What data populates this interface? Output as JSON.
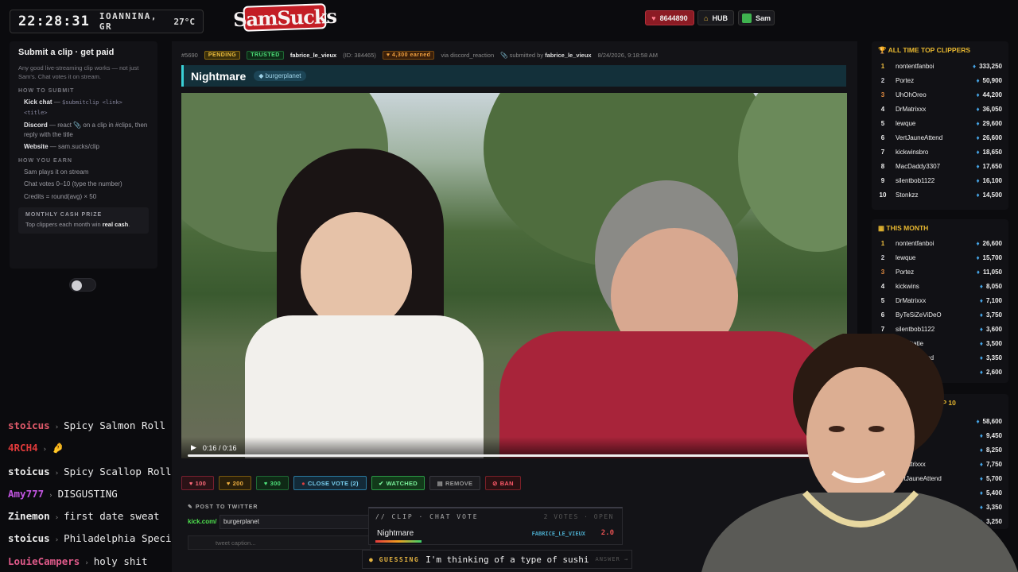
{
  "header": {
    "time": "22:28:31",
    "location": "IOANNINA, GR",
    "temp": "27°C",
    "logo": "SamSucks",
    "credits": "8644890",
    "hub": "HUB",
    "user": "Sam"
  },
  "left": {
    "title": "Submit a clip · get paid",
    "intro": "Any good live-streaming clip works — not just Sam's. Chat votes it on stream.",
    "how_submit": "HOW TO SUBMIT",
    "kick_l": "Kick chat",
    "kick_r": " — ",
    "kick_code": "$submitclip <link> <title>",
    "discord_l": "Discord",
    "discord_r": " — react 📎 on a clip in #clips, then reply with the title",
    "web_l": "Website",
    "web_r": " — sam.sucks/clip",
    "how_earn": "HOW YOU EARN",
    "earn": [
      "Sam plays it on stream",
      "Chat votes 0–10 (type the number)",
      "Credits = round(avg) × 50"
    ],
    "prize_t": "MONTHLY CASH PRIZE",
    "prize_d": "Top clippers each month win ",
    "prize_b": "real cash",
    "prize_e": "."
  },
  "chat": [
    {
      "user": "stoicus",
      "color": "#e05a6a",
      "msg": "Spicy Salmon Roll"
    },
    {
      "user": "4RCH4",
      "color": "#e03a3a",
      "msg": "🤌"
    },
    {
      "user": "stoicus",
      "color": "#ececec",
      "msg": "Spicy Scallop Roll"
    },
    {
      "user": "Amy777",
      "color": "#c255e0",
      "msg": "DISGUSTING"
    },
    {
      "user": "Zinemon",
      "color": "#ececec",
      "msg": "first date sweat"
    },
    {
      "user": "stoicus",
      "color": "#ececec",
      "msg": "Philadelphia Special Roll"
    },
    {
      "user": "LouieCampers",
      "color": "#e05a8a",
      "msg": "holy shit"
    }
  ],
  "clip": {
    "id": "#5690",
    "status": "PENDING",
    "trust": "TRUSTED",
    "author": "fabrice_le_vieux",
    "author_id": "(ID: 384465)",
    "earned": "4,300 earned",
    "via": "via discord_reaction",
    "submitted_label": "submitted by",
    "submitted_by": "fabrice_le_vieux",
    "date": "8/24/2026, 9:18:58 AM",
    "title": "Nightmare",
    "tag": "burgerplanet",
    "time": "0:16 / 0:16",
    "actions": [
      "100",
      "200",
      "300",
      "CLOSE VOTE (2)",
      "WATCHED",
      "REMOVE",
      "BAN"
    ],
    "post_label": "POST TO TWITTER",
    "kick_label": "kick.com/",
    "kick_value": "burgerplanet",
    "caption_placeholder": "tweet caption..."
  },
  "vote": {
    "header": "// CLIP · CHAT VOTE",
    "status": "2 VOTES · OPEN",
    "name": "Nightmare",
    "submitter": "FABRICE_LE_VIEUX",
    "score": "2.0"
  },
  "guess": {
    "label": "GUESSING",
    "question": "I'm thinking of a type of sushi",
    "answer": "ANSWER →"
  },
  "alltime": {
    "title": "ALL TIME TOP CLIPPERS",
    "rows": [
      {
        "r": "1",
        "n": "nontentfanboi",
        "c": "333,250"
      },
      {
        "r": "2",
        "n": "Portez",
        "c": "50,900"
      },
      {
        "r": "3",
        "n": "UhOhOreo",
        "c": "44,200"
      },
      {
        "r": "4",
        "n": "DrMatrixxx",
        "c": "36,050"
      },
      {
        "r": "5",
        "n": "lewque",
        "c": "29,600"
      },
      {
        "r": "6",
        "n": "VertJauneAttend",
        "c": "26,600"
      },
      {
        "r": "7",
        "n": "kickwinsbro",
        "c": "18,650"
      },
      {
        "r": "8",
        "n": "MacDaddy3307",
        "c": "17,650"
      },
      {
        "r": "9",
        "n": "silentbob1122",
        "c": "16,100"
      },
      {
        "r": "10",
        "n": "Stonkzz",
        "c": "14,500"
      }
    ]
  },
  "month": {
    "title": "THIS MONTH",
    "rows": [
      {
        "r": "1",
        "n": "nontentfanboi",
        "c": "26,600"
      },
      {
        "r": "2",
        "n": "lewque",
        "c": "15,700"
      },
      {
        "r": "3",
        "n": "Portez",
        "c": "11,050"
      },
      {
        "r": "4",
        "n": "kickwins",
        "c": "8,050"
      },
      {
        "r": "5",
        "n": "DrMatrixxx",
        "c": "7,100"
      },
      {
        "r": "6",
        "n": "ByTeSiZeViDeO",
        "c": "3,750"
      },
      {
        "r": "7",
        "n": "silentbob1122",
        "c": "3,600"
      },
      {
        "r": "8",
        "n": "kinkykatie",
        "c": "3,500"
      },
      {
        "r": "9",
        "n": "…auneattend",
        "c": "3,350"
      },
      {
        "r": "10",
        "n": "…e",
        "c": "2,600"
      }
    ]
  },
  "third": {
    "title": "…P 10",
    "rows": [
      {
        "c": "58,600"
      },
      {
        "c": "9,450"
      },
      {
        "c": "8,250"
      },
      {
        "n": "…Matrixxx",
        "c": "7,750"
      },
      {
        "n": "…rtJauneAttend",
        "c": "5,700"
      },
      {
        "c": "5,400"
      },
      {
        "c": "3,350"
      },
      {
        "c": "3,250"
      }
    ]
  }
}
